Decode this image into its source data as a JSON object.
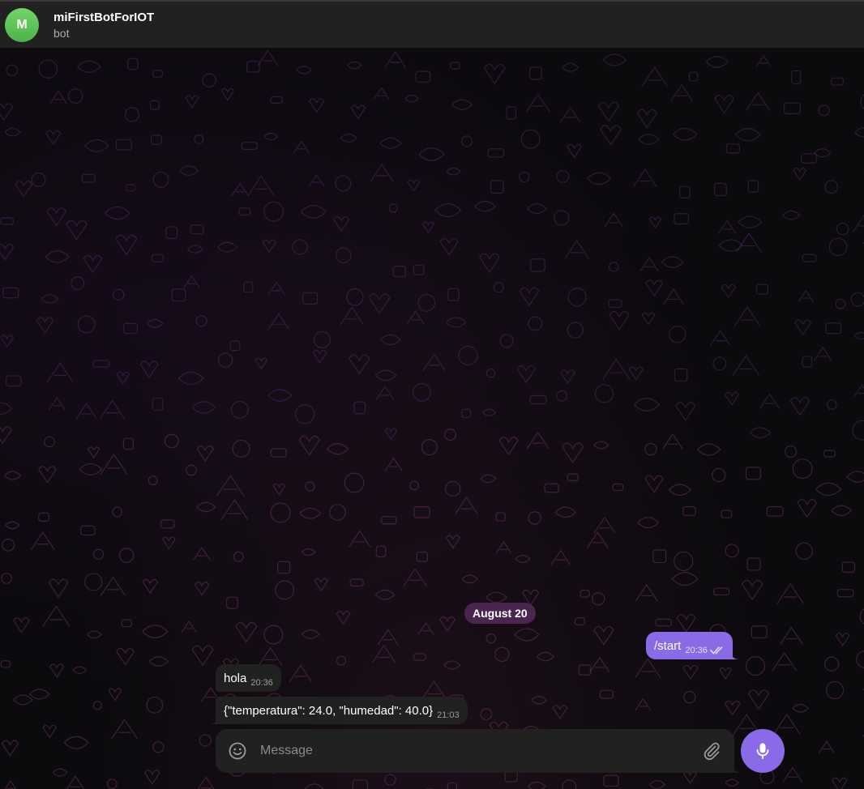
{
  "header": {
    "avatar_letter": "M",
    "title": "miFirstBotForIOT",
    "subtitle": "bot"
  },
  "chat": {
    "date_separator": "August 20",
    "messages": [
      {
        "direction": "outgoing",
        "text": "/start",
        "time": "20:36",
        "status": "read"
      },
      {
        "direction": "incoming",
        "text": "hola",
        "time": "20:36"
      },
      {
        "direction": "incoming",
        "text": "{\"temperatura\": 24.0, \"humedad\": 40.0}",
        "time": "21:03"
      }
    ]
  },
  "composer": {
    "placeholder": "Message",
    "value": "",
    "emoji_icon": "smile-icon",
    "attach_icon": "paperclip-icon",
    "send_icon": "microphone-icon"
  },
  "colors": {
    "accent": "#8b6ae8",
    "header_bg": "#212121",
    "incoming_bubble": "#212121",
    "outgoing_bubble": "#8b6ae8",
    "date_pill": "#4a2550",
    "avatar": "#5cc455",
    "background": "#0b0a0d"
  }
}
